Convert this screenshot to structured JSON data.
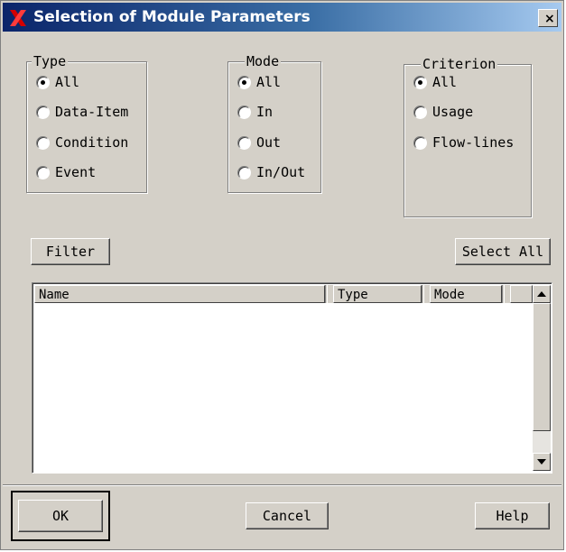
{
  "window": {
    "title": "Selection of Module Parameters",
    "close_label": "×"
  },
  "type_group": {
    "label": "Type",
    "options": [
      "All",
      "Data-Item",
      "Condition",
      "Event"
    ],
    "selected": "All"
  },
  "mode_group": {
    "label": "Mode",
    "options": [
      "All",
      "In",
      "Out",
      "In/Out"
    ],
    "selected": "All"
  },
  "criterion_group": {
    "label": "Criterion",
    "options": [
      "All",
      "Usage",
      "Flow-lines"
    ],
    "selected": "All"
  },
  "buttons": {
    "filter": "Filter",
    "select_all": "Select All",
    "ok": "OK",
    "cancel": "Cancel",
    "help": "Help"
  },
  "list": {
    "columns": [
      "Name",
      "Type",
      "Mode"
    ],
    "rows": []
  },
  "colors": {
    "face": "#d4d0c8",
    "title_start": "#0a246a",
    "title_end": "#a6caf0",
    "icon_x": "#d40000"
  }
}
